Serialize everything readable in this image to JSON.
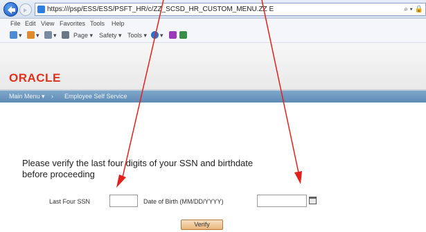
{
  "browser": {
    "url": "https://",
    "url_tail": "/psp/ESS/ESS/PSFT_HR/c/ZZ_SCSD_HR_CUSTOM_MENU.ZZ E",
    "url_search": "⌕ ▾ 🔒"
  },
  "menu": {
    "items": [
      "File",
      "Edit",
      "View",
      "Favorites",
      "Tools",
      "Help"
    ]
  },
  "commandbar": {
    "items": [
      "▾",
      "▾",
      "▾",
      "Page ▾",
      "Safety ▾",
      "Tools ▾",
      "▾"
    ]
  },
  "header": {
    "logo_text": "ORACLE"
  },
  "nav": {
    "main_menu": "Main Menu ▾",
    "separator": "›",
    "employee_self_service": "Employee Self Service"
  },
  "content": {
    "prompt_line1": "Please verify the last four digits of your SSN and birthdate",
    "prompt_line2": "before proceeding",
    "ssn_label": "Last Four SSN",
    "dob_label": "Date of Birth (MM/DD/YYYY)",
    "ssn_value": "",
    "dob_value": "",
    "verify_label": "Verify"
  },
  "colors": {
    "oracle_red": "#e0311c",
    "nav_blue": "#6f98c0",
    "verify_orange": "#e9b47a",
    "annotation_red": "#e2211c"
  }
}
